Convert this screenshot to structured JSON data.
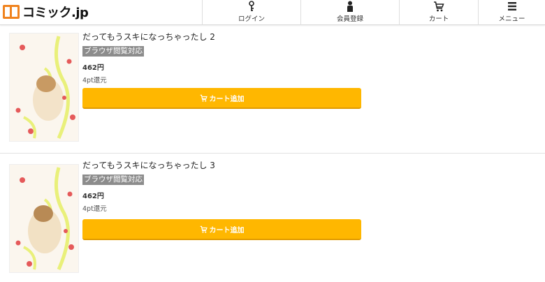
{
  "header": {
    "logo_text": "コミック.jp",
    "nav": [
      {
        "label": "ログイン",
        "icon": "key-icon"
      },
      {
        "label": "会員登録",
        "icon": "user-icon"
      },
      {
        "label": "カート",
        "icon": "cart-icon"
      },
      {
        "label": "メニュー",
        "icon": "menu-icon"
      }
    ]
  },
  "products": [
    {
      "title": "だってもうスキになっちゃったし 2",
      "badge": "ブラウザ閲覧対応",
      "price": "462円",
      "points": "4pt還元",
      "cart_button": "カート追加"
    },
    {
      "title": "だってもうスキになっちゃったし 3",
      "badge": "ブラウザ閲覧対応",
      "price": "462円",
      "points": "4pt還元",
      "cart_button": "カート追加"
    }
  ],
  "colors": {
    "accent": "#ffb700",
    "logo": "#f0831e",
    "badge": "#8c8c8c"
  }
}
